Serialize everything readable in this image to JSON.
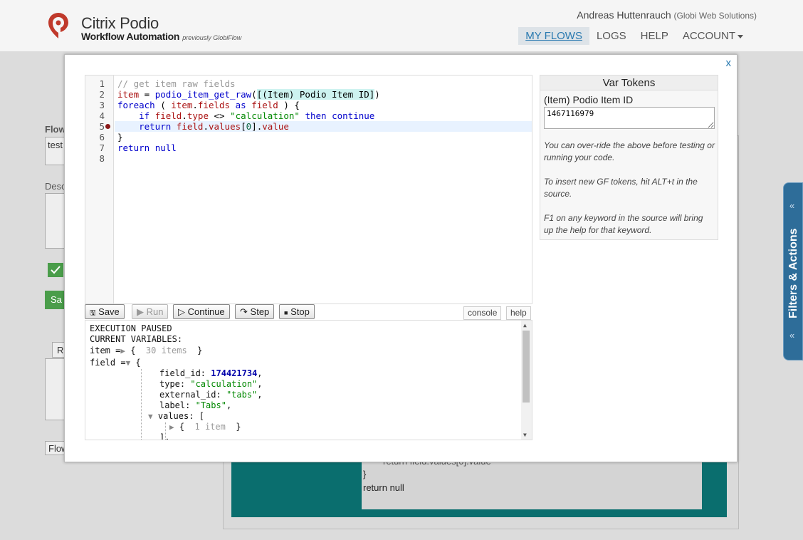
{
  "header": {
    "brand": "Citrix Podio",
    "product": "Workflow Automation",
    "previously": "previously GlobiFlow",
    "user_name": "Andreas Huttenrauch",
    "user_org": "(Globi Web Solutions)",
    "nav": [
      {
        "label": "MY FLOWS",
        "active": true
      },
      {
        "label": "LOGS"
      },
      {
        "label": "HELP"
      },
      {
        "label": "ACCOUNT"
      }
    ]
  },
  "background": {
    "flow_label": "Flow",
    "flow_value": "test",
    "desc_label": "Desc",
    "save_label": "Sa",
    "r_label": "R",
    "flow2_label": "Flow",
    "code_tail_1": "return field.values[0].value",
    "code_tail_2": "}",
    "code_tail_3": "return null",
    "side_tab": "Filters & Actions"
  },
  "modal": {
    "close": "x",
    "gutter": [
      "1",
      "2",
      "3",
      "4",
      "5",
      "6",
      "7",
      "8"
    ],
    "toolbar": {
      "save": "Save",
      "run": "Run",
      "continue": "Continue",
      "step": "Step",
      "stop": "Stop",
      "console_tab": "console",
      "help_tab": "help"
    },
    "console": {
      "status": "EXECUTION PAUSED",
      "vars_header": "CURRENT VARIABLES:",
      "item_name": "item =",
      "item_summary": "30 items",
      "field_name": "field =",
      "field_id_key": "field_id:",
      "field_id_val": "174421734",
      "type_key": "type:",
      "type_val": "\"calculation\"",
      "external_id_key": "external_id:",
      "external_id_val": "\"tabs\"",
      "label_key": "label:",
      "label_val": "\"Tabs\"",
      "values_key": "values: [",
      "values_item": "1 item",
      "close_bracket": "],"
    },
    "vars": {
      "title": "Var Tokens",
      "token_label": "(Item) Podio Item ID",
      "token_value": "1467116979",
      "note1": "You can over-ride the above before testing or running your code.",
      "note2": "To insert new GF tokens, hit ALT+t in the source.",
      "note3": "F1 on any keyword in the source will bring up the help for that keyword."
    }
  },
  "colors": {
    "accent": "#2a7ab0",
    "brand_red": "#c0392b",
    "breakpoint": "#8b1a1a",
    "side_tab": "#2e6d99",
    "teal": "#0a6e6e"
  }
}
